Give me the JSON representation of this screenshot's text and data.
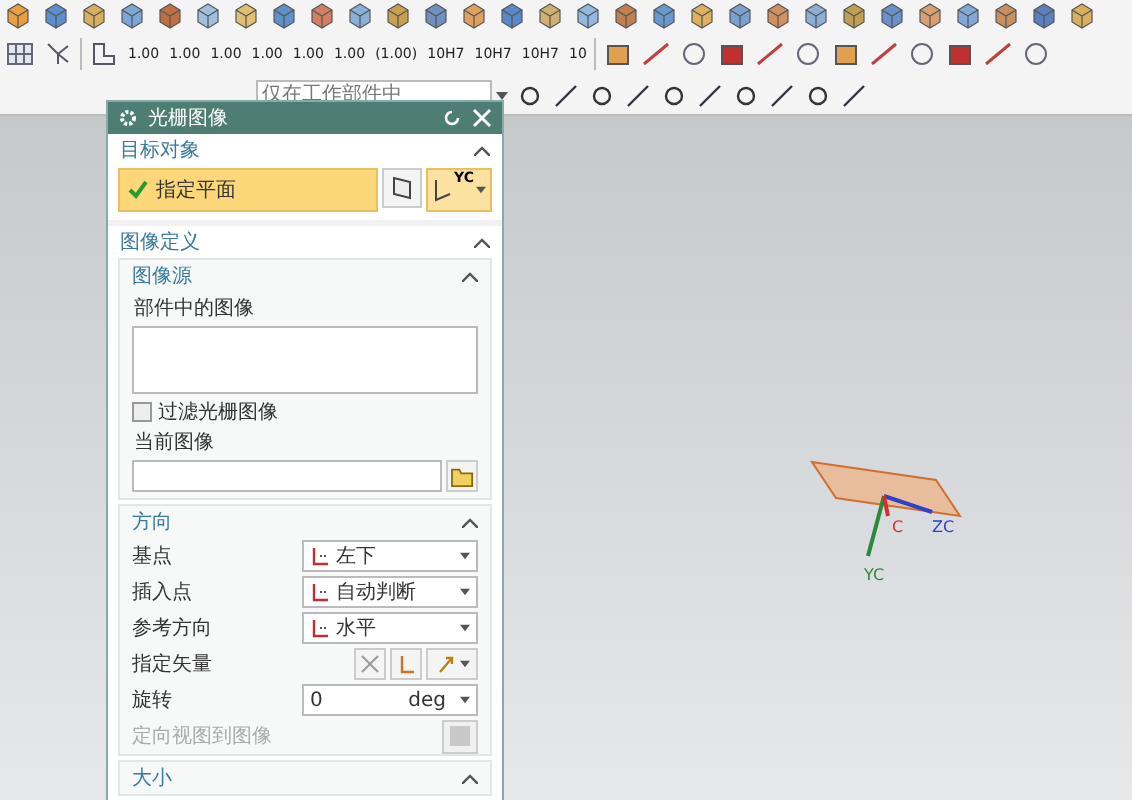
{
  "toolbar": {
    "dimension_tools": [
      "1.00",
      "1.00",
      "1.00",
      "1.00",
      "1.00",
      "1.00",
      "(1.00)",
      "10H7",
      "10H7",
      "10H7",
      "10"
    ],
    "filter": {
      "placeholder": "仅在工作部件中"
    }
  },
  "dialog": {
    "title": "光栅图像",
    "target": {
      "title": "目标对象",
      "expanded": true,
      "selector": {
        "label": "指定平面",
        "selected": true
      },
      "axis_label": "YC"
    },
    "definition": {
      "title": "图像定义",
      "expanded": true,
      "source": {
        "title": "图像源",
        "expanded": true,
        "list_label": "部件中的图像",
        "filter": {
          "label": "过滤光栅图像",
          "checked": false
        },
        "current_label": "当前图像"
      },
      "orientation": {
        "title": "方向",
        "expanded": true,
        "rows": [
          {
            "kind": "dropdown",
            "label": "基点",
            "value": "左下"
          },
          {
            "kind": "dropdown",
            "label": "插入点",
            "value": "自动判断"
          },
          {
            "kind": "dropdown",
            "label": "参考方向",
            "value": "水平"
          },
          {
            "kind": "vector",
            "label": "指定矢量"
          },
          {
            "kind": "number",
            "label": "旋转",
            "value": "0",
            "unit": "deg"
          },
          {
            "kind": "button",
            "label": "定向视图到图像",
            "disabled": true
          }
        ]
      },
      "size": {
        "title": "大小",
        "expanded": true
      }
    }
  },
  "viewport": {
    "axis_labels": [
      {
        "kind": "z",
        "text": "ZC"
      },
      {
        "kind": "y",
        "text": "YC"
      },
      {
        "kind": "x",
        "text": "C"
      }
    ]
  }
}
